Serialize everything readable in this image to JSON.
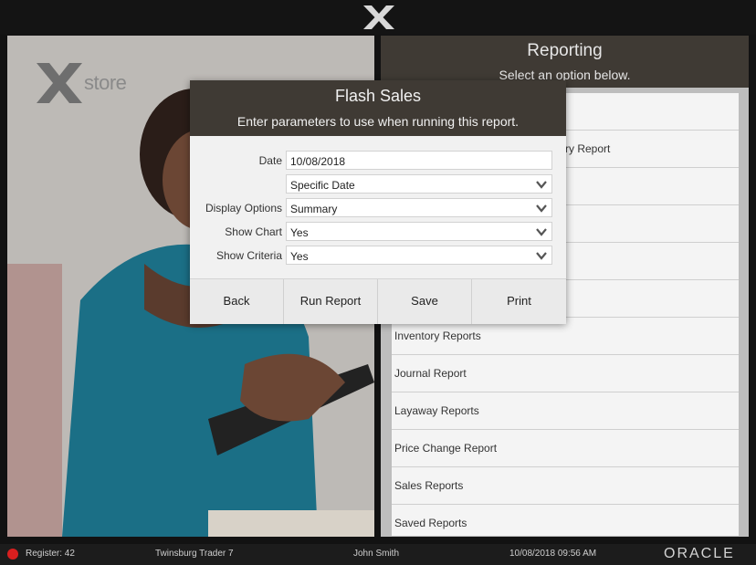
{
  "brand": {
    "wordmark": "store"
  },
  "reporting": {
    "title": "Reporting",
    "subtitle": "Select an option below.",
    "items": [
      "",
      "ry Report",
      "",
      "",
      "",
      "",
      "Inventory Reports",
      "Journal Report",
      "Layaway Reports",
      "Price Change Report",
      "Sales Reports",
      "Saved Reports"
    ]
  },
  "dialog": {
    "title": "Flash Sales",
    "subtitle": "Enter parameters to use when running this report.",
    "fields": [
      {
        "label": "Date",
        "value": "10/08/2018",
        "dropdown": false
      },
      {
        "label": "",
        "value": "Specific Date",
        "dropdown": true
      },
      {
        "label": "Display Options",
        "value": "Summary",
        "dropdown": true
      },
      {
        "label": "Show Chart",
        "value": "Yes",
        "dropdown": true
      },
      {
        "label": "Show Criteria",
        "value": "Yes",
        "dropdown": true
      }
    ],
    "buttons": {
      "back": "Back",
      "run": "Run Report",
      "save": "Save",
      "print": "Print"
    }
  },
  "status": {
    "register": "Register: 42",
    "store": "Twinsburg Trader 7",
    "user": "John Smith",
    "datetime": "10/08/2018 09:56 AM",
    "vendor": "ORACLE"
  },
  "colors": {
    "header_brown": "#3f3a34",
    "status_dot": "#d81f1f",
    "panel_bg": "#f4f4f4"
  }
}
